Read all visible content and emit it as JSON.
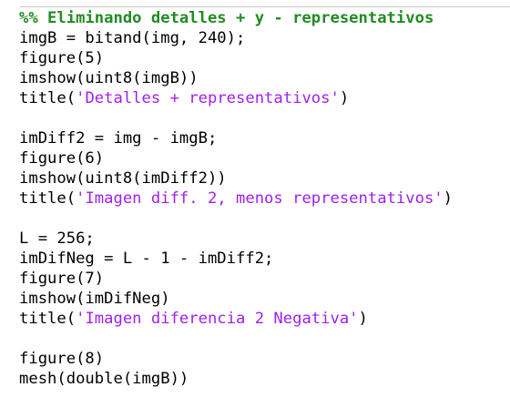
{
  "editor": {
    "colors": {
      "code": "#000000",
      "section_comment": "#228B22",
      "string": "#A020F0",
      "divider": "#C8C8C8"
    },
    "lines": {
      "l01": "%% Eliminando detalles + y - representativos",
      "l02": "imgB = bitand(img, 240);",
      "l03": "figure(5)",
      "l04": "imshow(uint8(imgB))",
      "l05_pre": "title(",
      "l05_str": "'Detalles + representativos'",
      "l05_post": ")",
      "l07": "imDiff2 = img - imgB;",
      "l08": "figure(6)",
      "l09": "imshow(uint8(imDiff2))",
      "l10_pre": "title(",
      "l10_str": "'Imagen diff. 2, menos representativos'",
      "l10_post": ")",
      "l12": "L = 256;",
      "l13": "imDifNeg = L - 1 - imDiff2;",
      "l14": "figure(7)",
      "l15": "imshow(imDifNeg)",
      "l16_pre": "title(",
      "l16_str": "'Imagen diferencia 2 Negativa'",
      "l16_post": ")",
      "l18": "figure(8)",
      "l19": "mesh(double(imgB))"
    }
  }
}
